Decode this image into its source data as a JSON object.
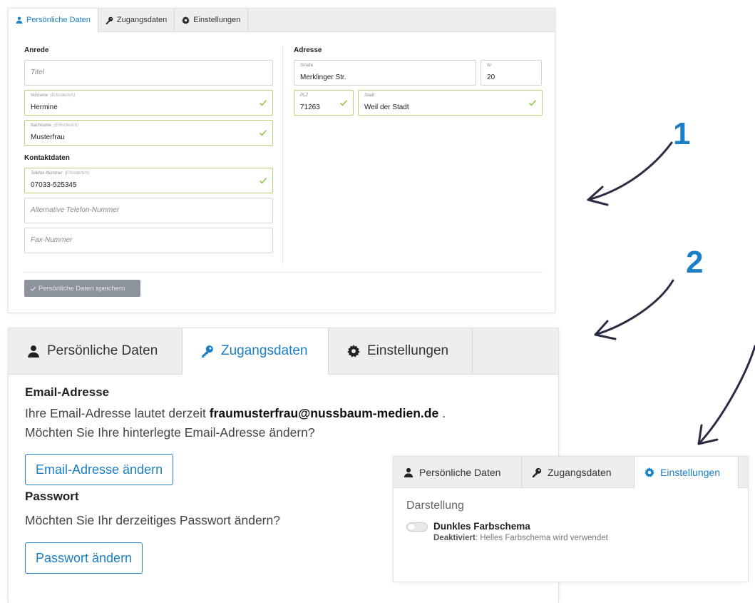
{
  "panel1": {
    "tabs": [
      {
        "label": "Persönliche Daten",
        "active": true,
        "icon": "user-icon"
      },
      {
        "label": "Zugangsdaten",
        "active": false,
        "icon": "key-icon"
      },
      {
        "label": "Einstellungen",
        "active": false,
        "icon": "gear-icon"
      }
    ],
    "left": {
      "anrede_title": "Anrede",
      "titel_placeholder": "Titel",
      "vorname_label": "Vorname",
      "vorname_req": "(Erforderlich)",
      "vorname_value": "Hermine",
      "nachname_label": "Nachname",
      "nachname_req": "(Erforderlich)",
      "nachname_value": "Musterfrau",
      "kontakt_title": "Kontaktdaten",
      "telefon_label": "Telefon-Nummer",
      "telefon_req": "(Erforderlich)",
      "telefon_value": "07033-525345",
      "alt_telefon_placeholder": "Alternative Telefon-Nummer",
      "fax_placeholder": "Fax-Nummer"
    },
    "right": {
      "adresse_title": "Adresse",
      "strasse_label": "Straße",
      "strasse_value": "Merklinger Str.",
      "nr_label": "Nr",
      "nr_value": "20",
      "plz_label": "PLZ",
      "plz_value": "71263",
      "stadt_label": "Stadt",
      "stadt_value": "Weil der Stadt"
    },
    "save_label": "Persönliche Daten speichern"
  },
  "panel2": {
    "tabs": [
      {
        "label": "Persönliche Daten",
        "active": false,
        "icon": "user-icon"
      },
      {
        "label": "Zugangsdaten",
        "active": true,
        "icon": "key-icon"
      },
      {
        "label": "Einstellungen",
        "active": false,
        "icon": "gear-icon"
      }
    ],
    "email_title": "Email-Adresse",
    "email_text_before": "Ihre Email-Adresse lautet derzeit",
    "email_address": "fraumusterfrau@nussbaum-medien.de",
    "email_text_after": ".",
    "email_question": "Möchten Sie Ihre hinterlegte Email-Adresse ändern?",
    "email_button": "Email-Adresse ändern",
    "password_title": "Passwort",
    "password_question": "Möchten Sie Ihr derzeitiges Passwort ändern?",
    "password_button": "Passwort ändern"
  },
  "panel3": {
    "tabs": [
      {
        "label": "Persönliche Daten",
        "active": false,
        "icon": "user-icon"
      },
      {
        "label": "Zugangsdaten",
        "active": false,
        "icon": "key-icon"
      },
      {
        "label": "Einstellungen",
        "active": true,
        "icon": "gear-icon"
      }
    ],
    "section_title": "Darstellung",
    "option_title": "Dunkles Farbschema",
    "option_status": "Deaktiviert",
    "option_desc": ": Helles Farbschema wird verwendet",
    "toggle_on": false
  },
  "annotations": {
    "step1": "1",
    "step2": "2",
    "accent_color": "#1a7fc4",
    "valid_color": "#8dc63f",
    "arrow_color": "#2b2d42"
  }
}
